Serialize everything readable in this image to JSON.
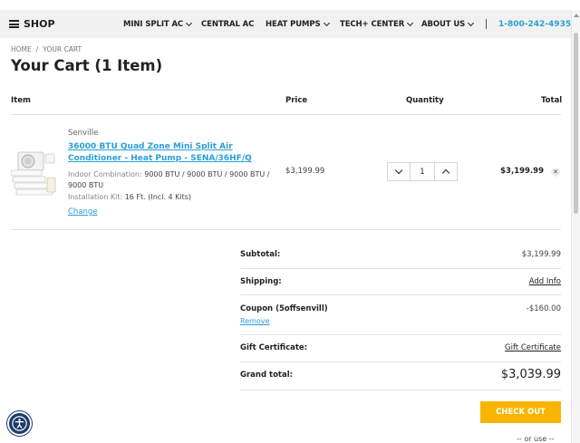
{
  "nav": {
    "shop_label": "SHOP",
    "items": [
      {
        "label": "MINI SPLIT AC",
        "has_dropdown": true
      },
      {
        "label": "CENTRAL AC",
        "has_dropdown": false
      },
      {
        "label": "HEAT PUMPS",
        "has_dropdown": true
      },
      {
        "label": "TECH+ CENTER",
        "has_dropdown": true
      },
      {
        "label": "ABOUT US",
        "has_dropdown": true
      }
    ],
    "phone": "1-800-242-4935",
    "accent_color": "#2a9fd6"
  },
  "breadcrumb": [
    "HOME",
    "YOUR CART"
  ],
  "page_title": "Your Cart (1 Item)",
  "table": {
    "headers": {
      "item": "Item",
      "price": "Price",
      "quantity": "Quantity",
      "total": "Total"
    }
  },
  "cart_item": {
    "brand": "Senville",
    "title": "36000 BTU Quad Zone Mini Split Air Conditioner - Heat Pump - SENA/36HF/Q",
    "options": [
      {
        "label": "Indoor Combination:",
        "value": "9000 BTU / 9000 BTU / 9000 BTU / 9000 BTU"
      },
      {
        "label": "Installation Kit:",
        "value": "16 Ft. (Incl. 4 Kits)"
      }
    ],
    "change_label": "Change",
    "price": "$3,199.99",
    "quantity": "1",
    "total": "$3,199.99",
    "remove_icon": "close-icon"
  },
  "summary": {
    "subtotal_label": "Subtotal:",
    "subtotal_value": "$3,199.99",
    "shipping_label": "Shipping:",
    "shipping_link": "Add Info",
    "coupon_label": "Coupon (5offsenvill)",
    "coupon_value": "-$160.00",
    "coupon_remove": "Remove",
    "gift_label": "Gift Certificate:",
    "gift_link": "Gift Certificate",
    "grand_label": "Grand total:",
    "grand_value": "$3,039.99"
  },
  "checkout_label": "CHECK OUT",
  "or_use_label": "-- or use --",
  "checkout_color": "#f7b500"
}
